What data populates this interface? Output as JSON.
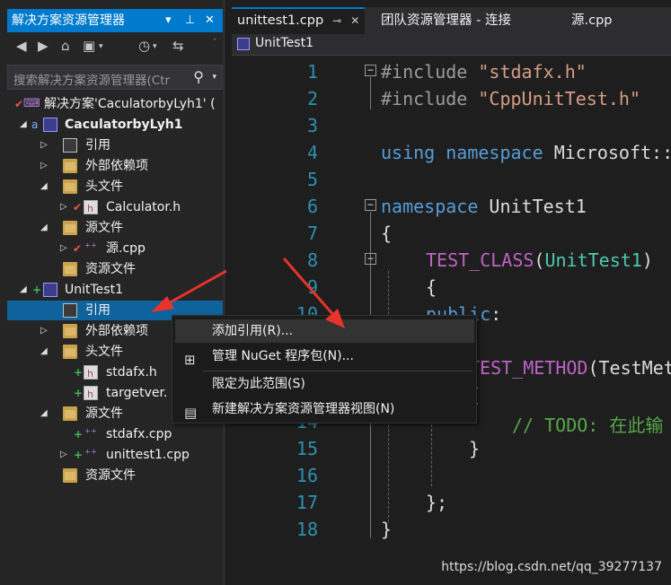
{
  "solution_explorer": {
    "title": "解决方案资源管理器",
    "title_buttons": [
      "▾",
      "📌",
      "✕"
    ],
    "search_placeholder": "搜索解决方案资源管理器(Ctr",
    "tree": [
      {
        "id": "solution",
        "label": "解决方案'CaculatorbyLyh1' (",
        "icon": "vs-solution-icon"
      },
      {
        "id": "proj1",
        "label": "CaculatorbyLyh1",
        "icon": "project-icon",
        "bold": true
      },
      {
        "id": "refs1",
        "label": "引用",
        "icon": "reference-icon"
      },
      {
        "id": "extdeps1",
        "label": "外部依赖项",
        "icon": "folder-icon"
      },
      {
        "id": "headers1",
        "label": "头文件",
        "icon": "folder-icon"
      },
      {
        "id": "calc_h",
        "label": "Calculator.h",
        "icon": "header-file-icon"
      },
      {
        "id": "src1",
        "label": "源文件",
        "icon": "folder-icon"
      },
      {
        "id": "yuan_cpp",
        "label": "源.cpp",
        "icon": "cpp-file-icon"
      },
      {
        "id": "res1",
        "label": "资源文件",
        "icon": "folder-icon"
      },
      {
        "id": "proj2",
        "label": "UnitTest1",
        "icon": "project-icon"
      },
      {
        "id": "refs2",
        "label": "引用",
        "icon": "reference-icon",
        "selected": true
      },
      {
        "id": "extdeps2",
        "label": "外部依赖项",
        "icon": "folder-icon"
      },
      {
        "id": "headers2",
        "label": "头文件",
        "icon": "folder-icon"
      },
      {
        "id": "stdafx_h",
        "label": "stdafx.h",
        "icon": "header-file-icon"
      },
      {
        "id": "targetver_h",
        "label": "targetver.",
        "icon": "header-file-icon"
      },
      {
        "id": "src2",
        "label": "源文件",
        "icon": "folder-icon"
      },
      {
        "id": "stdafx_cpp",
        "label": "stdafx.cpp",
        "icon": "cpp-file-icon"
      },
      {
        "id": "unittest1_cpp",
        "label": "unittest1.cpp",
        "icon": "cpp-file-icon"
      },
      {
        "id": "res2",
        "label": "资源文件",
        "icon": "folder-icon"
      }
    ]
  },
  "editor": {
    "tabs": [
      {
        "label": "unittest1.cpp",
        "active": true
      },
      {
        "label": "团队资源管理器 - 连接",
        "active": false
      },
      {
        "label": "源.cpp",
        "active": false
      }
    ],
    "nav_scope": "UnitTest1",
    "line_numbers": [
      "1",
      "2",
      "3",
      "4",
      "5",
      "6",
      "7",
      "8",
      "9",
      "10",
      "11",
      "12",
      "13",
      "14",
      "15",
      "16",
      "17",
      "18"
    ],
    "code": {
      "l1_directive": "#include",
      "l1_str": "\"stdafx.h\"",
      "l2_directive": "#include",
      "l2_str": "\"CppUnitTest.h\"",
      "l4_kw1": "using",
      "l4_kw2": "namespace",
      "l4_rest": "Microsoft::",
      "l6_kw": "namespace",
      "l6_rest": "UnitTest1",
      "l7": "{",
      "l8_macro": "TEST_CLASS",
      "l8_open": "(",
      "l8_type": "UnitTest1",
      "l8_close": ")",
      "l9": "{",
      "l10_kw": "public",
      "l10_colon": ":",
      "l12_macro": "TEST_METHOD",
      "l12_rest": "(TestMet",
      "l13": "{",
      "l14_comment": "// TODO: 在此输",
      "l15": "}",
      "l17": "};",
      "l18": "}"
    }
  },
  "context_menu": {
    "items": [
      {
        "label": "添加引用(R)...",
        "icon": "",
        "highlighted": true
      },
      {
        "label": "管理 NuGet 程序包(N)...",
        "icon": "nuget-package-icon"
      },
      {
        "label": "限定为此范围(S)",
        "icon": ""
      },
      {
        "label": "新建解决方案资源管理器视图(N)",
        "icon": "new-view-icon"
      }
    ]
  },
  "watermark": "https://blog.csdn.net/qq_39277137",
  "colors": {
    "accent": "#007acc",
    "selection": "#0e639c",
    "arrow": "#e8332a",
    "keyword": "#569cd6",
    "string": "#d69d85",
    "type": "#4ec9b0",
    "macro": "#bd63c5",
    "comment": "#57a64a"
  }
}
